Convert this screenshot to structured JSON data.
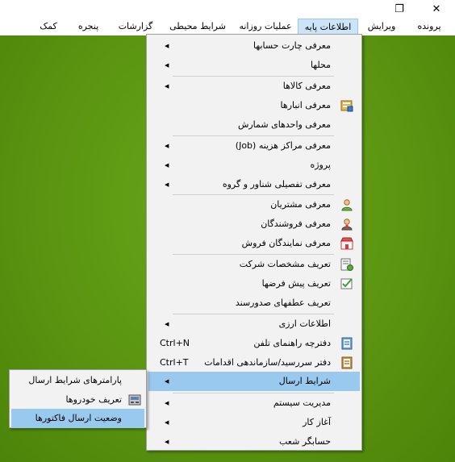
{
  "window": {
    "close_glyph": "✕",
    "restore_glyph": "❐"
  },
  "menubar": {
    "items": [
      {
        "label": "پرونده"
      },
      {
        "label": "ویرایش"
      },
      {
        "label": "اطلاعات پایه",
        "active": true
      },
      {
        "label": "عملیات روزانه"
      },
      {
        "label": "شرایط محیطی"
      },
      {
        "label": "گزارشات"
      },
      {
        "label": "پنجره"
      },
      {
        "label": "کمک"
      }
    ]
  },
  "main_menu": {
    "items": [
      {
        "label": "معرفی چارت حسابها",
        "submenu": true
      },
      {
        "label": "محلها",
        "submenu": true
      },
      {
        "label": "معرفی کالاها",
        "submenu": true
      },
      {
        "label": "معرفی انبارها",
        "icon": "warehouse-icon"
      },
      {
        "label": "معرفی  واحدهای شمارش"
      },
      {
        "label": "معرفی مراکز هزینه (Job)",
        "submenu": true
      },
      {
        "label": "پروژه",
        "submenu": true
      },
      {
        "label": "معرفی تفصیلی شناور و گروه",
        "submenu": true
      },
      {
        "label": "معرفی مشتریان",
        "icon": "customer-icon"
      },
      {
        "label": "معرفی فروشندگان",
        "icon": "seller-icon"
      },
      {
        "label": "معرفی نمایندگان فروش",
        "icon": "sales-rep-icon"
      },
      {
        "label": "تعریف مشخصات شرکت",
        "icon": "company-icon"
      },
      {
        "label": "تعریف پیش فرضها",
        "icon": "defaults-icon"
      },
      {
        "label": "تعریف عطفهای صدورسند"
      },
      {
        "label": "اطلاعات ارزی",
        "submenu": true
      },
      {
        "label": "دفترچه راهنمای تلفن",
        "icon": "phonebook-icon",
        "shortcut": "Ctrl+N"
      },
      {
        "label": "دفتر سررسید/سازماندهی اقدامات",
        "icon": "organizer-icon",
        "shortcut": "Ctrl+T"
      },
      {
        "label": "شرایط ارسال",
        "submenu": true,
        "highlight": true
      },
      {
        "label": "مدیریت سیستم",
        "submenu": true
      },
      {
        "label": "آغاز کار",
        "submenu": true
      },
      {
        "label": "حسابگر شعب",
        "submenu": true
      }
    ]
  },
  "sub_menu": {
    "items": [
      {
        "label": "پارامترهای شرایط ارسال"
      },
      {
        "label": "تعریف خودروها",
        "icon": "vehicle-icon"
      },
      {
        "label": "وضعیت ارسال فاکتورها",
        "highlight": true
      }
    ]
  },
  "colors": {
    "desktop_green": "#5b9511",
    "menu_background": "#f2f2f2",
    "highlight": "#99c9ef",
    "menubar_active": "#cce4f7"
  }
}
